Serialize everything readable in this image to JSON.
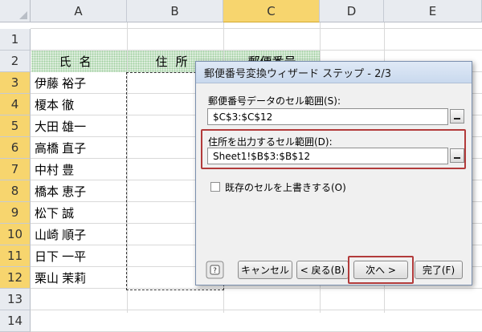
{
  "sheet": {
    "columns": [
      "A",
      "B",
      "C",
      "D",
      "E"
    ],
    "selected_column": "C",
    "rows": [
      "1",
      "2",
      "3",
      "4",
      "5",
      "6",
      "7",
      "8",
      "9",
      "10",
      "11",
      "12",
      "13",
      "14"
    ],
    "selected_rows": [
      "3",
      "4",
      "5",
      "6",
      "7",
      "8",
      "9",
      "10",
      "11",
      "12"
    ],
    "header_name": "氏名",
    "header_address": "住所",
    "header_postal": "郵便番号",
    "names": [
      "伊藤 裕子",
      "榎本 徹",
      "大田 雄一",
      "高橋 直子",
      "中村 豊",
      "橋本 恵子",
      "松下 誠",
      "山崎 順子",
      "日下 一平",
      "栗山 茉莉"
    ]
  },
  "dialog": {
    "title": "郵便番号変換ウィザード ステップ - 2/3",
    "postal_range_label": "郵便番号データのセル範囲(S):",
    "postal_range_value": "$C$3:$C$12",
    "address_range_label": "住所を出力するセル範囲(D):",
    "address_range_value": "Sheet1!$B$3:$B$12",
    "overwrite_label": "既存のセルを上書きする(O)",
    "overwrite_checked": false,
    "buttons": {
      "help": "?",
      "cancel": "キャンセル",
      "back": "< 戻る(B)",
      "next": "次へ >",
      "finish": "完了(F)"
    }
  },
  "colors": {
    "highlight_frame": "#b23b3b",
    "selected_header": "#f7d56e",
    "header_fill": "#dceddc"
  }
}
